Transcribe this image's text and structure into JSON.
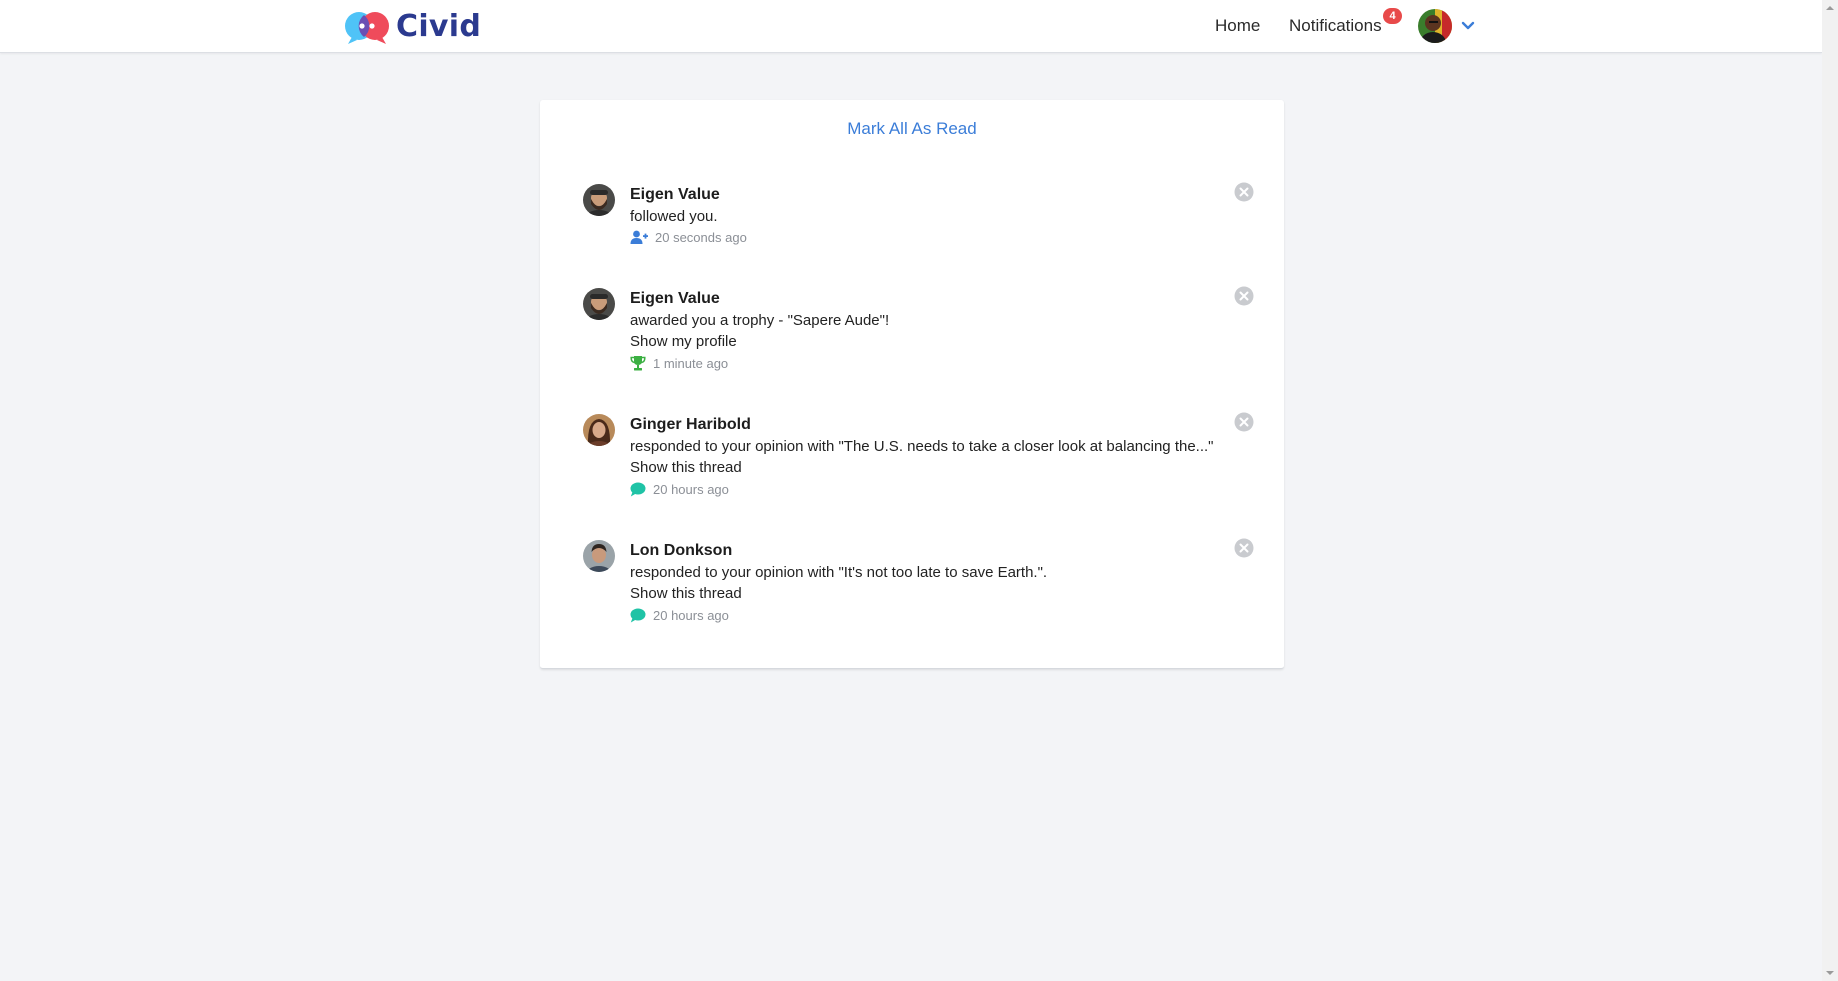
{
  "app": {
    "name": "Civid"
  },
  "nav": {
    "home_label": "Home",
    "notifications_label": "Notifications",
    "notifications_count": "4",
    "avatar_icon": "user-avatar",
    "menu_icon": "chevron-down-icon"
  },
  "colors": {
    "accent": "#3b7dd8",
    "badge": "#e84a4a",
    "trophy": "#3cb043",
    "comment": "#1fc3a6",
    "brand_text": "#2b3a8f"
  },
  "panel": {
    "mark_all_label": "Mark All As Read",
    "notifications": [
      {
        "name": "Eigen Value",
        "message": "followed you.",
        "link": "",
        "icon": "user-plus-icon",
        "time": "20 seconds ago"
      },
      {
        "name": "Eigen Value",
        "message": "awarded you a trophy - \"Sapere Aude\"!",
        "link": "Show my profile",
        "icon": "trophy-icon",
        "time": "1 minute ago"
      },
      {
        "name": "Ginger Haribold",
        "message": "responded to your opinion with \"The U.S. needs to take a closer look at balancing the...\"",
        "link": "Show this thread",
        "icon": "comment-icon",
        "time": "20 hours ago"
      },
      {
        "name": "Lon Donkson",
        "message": "responded to your opinion with \"It's not too late to save Earth.\".",
        "link": "Show this thread",
        "icon": "comment-icon",
        "time": "20 hours ago"
      }
    ]
  }
}
